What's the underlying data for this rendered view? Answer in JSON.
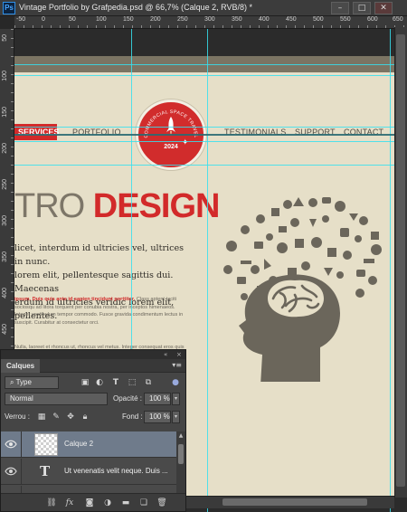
{
  "window": {
    "app_icon": "Ps",
    "title": "Vintage Portfolio by Grafpedia.psd @ 66,7% (Calque 2, RVB/8) *",
    "controls": [
      "–",
      "□",
      "✕"
    ]
  },
  "rulers": {
    "horizontal": [
      "-50",
      "0",
      "50",
      "100",
      "150",
      "200",
      "250",
      "300",
      "350",
      "400",
      "450",
      "500",
      "550",
      "600",
      "650"
    ],
    "vertical": [
      "50",
      "100",
      "150",
      "200",
      "250",
      "300",
      "350",
      "400",
      "450",
      "500",
      "550",
      "600",
      "650"
    ]
  },
  "document": {
    "nav": {
      "active": "SERVICES",
      "items": [
        "PORTFOLIO",
        "TESTIMONIALS",
        "SUPPORT",
        "CONTACT"
      ]
    },
    "badge": {
      "arc_text": "COMMERCIAL SPACE TRAVEL",
      "year": "2024"
    },
    "hero": {
      "light": "TRO ",
      "bold": "DESIGN"
    },
    "serif_lines": [
      "licet, interdum id ultricies vel, ultrices in nunc.",
      "lorem elit, pellentesque sagittis dui. Maecenas",
      "erdum id ultricies veridic  lorem elit, pellentes."
    ],
    "small_para_1": {
      "red": "ipsum. Duis quis ante id sapien tincidunt porttitor.",
      "rest": "Class aptent taciti sociosqu ad litora torquent per conubia nostra, per inceptos himenaeos. Integer vestibulum tempor commodo. Fusce gravida condimentum lectus in suscipit. Curabitur at consectetur orci."
    },
    "small_para_2": "Nulla, laoreet et rhoncus ut, rhoncus vel metus. Integer consequat eros quis posuere dapibus sapien eu lacus volutpat. Nunc est odio, faucibus id varius. Mauris venenatis pulvinar vestibulum. Vestibulum tellus purus, rhoncus, rutrum quis sapien."
  },
  "layers_panel": {
    "tab": "Calques",
    "collapse": "«",
    "close": "×",
    "menu_icon": "panel-menu-icon",
    "filter_type": "Type",
    "blend_mode": "Normal",
    "opacity_label": "Opacité :",
    "opacity_value": "100 %",
    "lock_label": "Verrou :",
    "fill_label": "Fond :",
    "fill_value": "100 %",
    "layers": [
      {
        "name": "Calque 2",
        "kind": "pixel",
        "selected": true
      },
      {
        "name": "Ut venenatis velit neque. Duis ...",
        "kind": "text",
        "selected": false
      },
      {
        "name": "...",
        "kind": "text",
        "selected": false
      }
    ],
    "bottom_icons": [
      "link-icon",
      "fx-icon",
      "mask-icon",
      "adjustment-icon",
      "group-folder-icon",
      "new-layer-icon",
      "trash-icon"
    ]
  },
  "colors": {
    "accent_red": "#d22a2a",
    "paper": "#e6dfc8",
    "guide_cyan": "#36e0ee",
    "selection_blue": "#6f7b8b"
  }
}
